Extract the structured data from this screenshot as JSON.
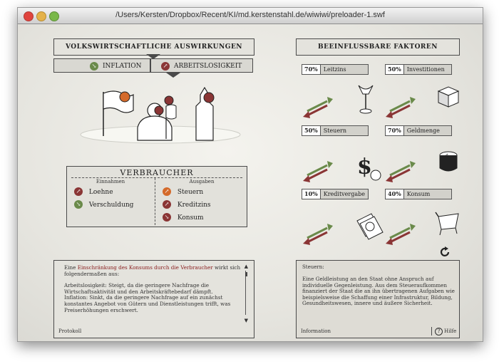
{
  "window": {
    "title": "/Users/Kersten/Dropbox/Recent/KI/md.kerstenstahl.de/wiwiwi/preloader-1.swf"
  },
  "left_header": "VOLKSWIRTSCHAFTLICHE AUSWIRKUNGEN",
  "tabs": [
    {
      "label": "INFLATION"
    },
    {
      "label": "ARBEITSLOSIGKEIT"
    }
  ],
  "consumer": {
    "title": "VERBRAUCHER",
    "col_income": "Einnahmen",
    "col_expense": "Ausgaben",
    "income": [
      {
        "label": "Loehne",
        "color": "#8a3535"
      },
      {
        "label": "Verschuldung",
        "color": "#6a8a4a"
      }
    ],
    "expense": [
      {
        "label": "Steuern",
        "color": "#d46a2a"
      },
      {
        "label": "Kreditzins",
        "color": "#8a3535"
      },
      {
        "label": "Konsum",
        "color": "#8a3535"
      }
    ]
  },
  "right_header": "BEEINFLUSSBARE FAKTOREN",
  "factors": [
    {
      "pct": "70%",
      "label": "Leitzins"
    },
    {
      "pct": "50%",
      "label": "Investitionen"
    },
    {
      "pct": "50%",
      "label": "Steuern"
    },
    {
      "pct": "70%",
      "label": "Geldmenge"
    },
    {
      "pct": "10%",
      "label": "Kreditvergabe"
    },
    {
      "pct": "40%",
      "label": "Konsum"
    }
  ],
  "protocol": {
    "intro_pre": "Eine",
    "intro_link": "Einschränkung des Konsums durch die Verbraucher",
    "intro_post": "wirkt sich folgendermaßen aus:",
    "para1": "Arbeitslosigkeit: Steigt, da die geringere Nachfrage die Wirtschaftsaktivität und den Arbeitskräftebedarf dämpft.",
    "para2": "Inflation: Sinkt, da die geringere Nachfrage auf ein zunächst konstantes Angebot von Gütern und Dienstleistungen trifft, was Preiserhöhungen erschwert.",
    "label": "Protokoll"
  },
  "info": {
    "heading": "Steuern:",
    "body": "Eine Geldleistung an den Staat ohne Anspruch auf individuelle Gegenleistung. Aus dem Steueraufkommen finanziert der Staat die an ihn übertragenen Aufgaben wie beispielsweise die Schaffung einer Infrastruktur, Bildung, Gesundheitswesen, innere und äußere Sicherheit.",
    "label": "Information",
    "help_label": "Hilfe"
  },
  "colors": {
    "green": "#6a8a4a",
    "red": "#8a3535",
    "orange": "#d46a2a",
    "link": "#8a2020"
  }
}
